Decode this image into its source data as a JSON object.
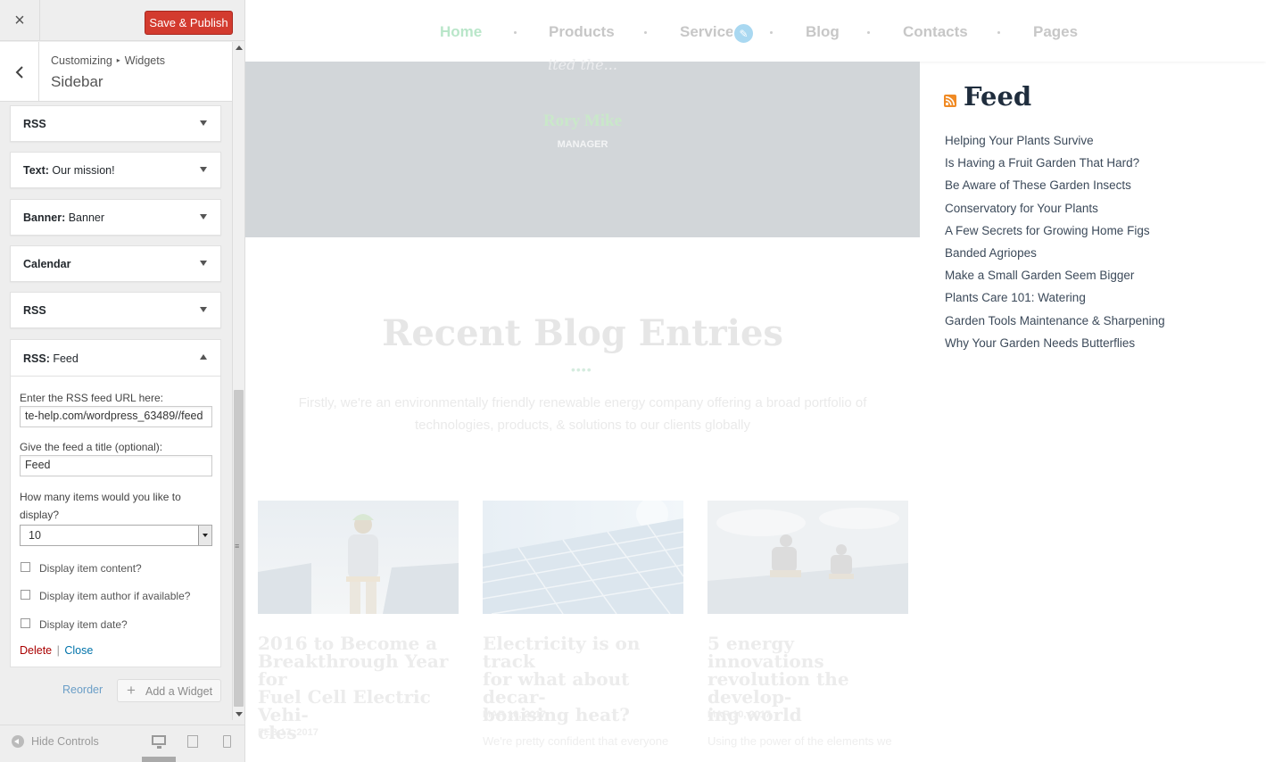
{
  "customizer": {
    "save_label": "Save & Publish",
    "close_icon": "×",
    "breadcrumb": {
      "root": "Customizing",
      "sep": "▸",
      "section": "Widgets"
    },
    "section_title": "Sidebar",
    "widgets": [
      {
        "type": "RSS",
        "title": ""
      },
      {
        "type": "Text:",
        "title": " Our mission!"
      },
      {
        "type": "Banner:",
        "title": " Banner"
      },
      {
        "type": "Calendar",
        "title": ""
      },
      {
        "type": "RSS",
        "title": ""
      }
    ],
    "open_widget": {
      "type": "RSS:",
      "title": " Feed",
      "url_label": "Enter the RSS feed URL here:",
      "url_value": "te-help.com/wordpress_63489//feed",
      "title_label": "Give the feed a title (optional):",
      "title_value": "Feed",
      "count_label_1": "How many items would you like to",
      "count_label_2": "display?",
      "count_value": "10",
      "checkboxes": [
        {
          "label": "Display item content?",
          "checked": false
        },
        {
          "label": "Display item author if available?",
          "checked": false
        },
        {
          "label": "Display item date?",
          "checked": false
        }
      ],
      "delete_label": "Delete",
      "separator": "|",
      "close_label": "Close"
    },
    "reorder_label": "Reorder",
    "add_widget_label": "Add a Widget",
    "hide_controls_label": "Hide Controls"
  },
  "preview": {
    "nav": [
      "Home",
      "Products",
      "Service",
      "Blog",
      "Contacts",
      "Pages"
    ],
    "nav_active": "Home",
    "hero": {
      "quote_fragment": "ited the...",
      "name": "Rory Mike",
      "role": "MANAGER"
    },
    "blog": {
      "title": "Recent Blog Entries",
      "dots": "••••",
      "subtitle_1": "Firstly, we're an environmentally friendly renewable energy company offering a broad portfolio of",
      "subtitle_2": "technologies, products, & solutions to our clients globally",
      "cards": [
        {
          "title_1": "2016 to Become a",
          "title_2": "Breakthrough Year for",
          "title_3": "Fuel Cell Electric Vehi-",
          "title_4": "cles",
          "date": "FEB 17, 2017",
          "excerpt": ""
        },
        {
          "title_1": "Electricity is on track",
          "title_2": "for what about decar-",
          "title_3": "bonising heat?",
          "title_4": "",
          "date": "MAR 10, 2017",
          "excerpt": "We're pretty confident that everyone"
        },
        {
          "title_1": "5 energy innovations",
          "title_2": "revolution the develop-",
          "title_3": "ing world",
          "title_4": "",
          "date": "MAR 10, 2017",
          "excerpt": "Using the power of the elements we"
        }
      ]
    },
    "feed": {
      "title": "Feed",
      "items": [
        "Helping Your Plants Survive",
        "Is Having a Fruit Garden That Hard?",
        "Be Aware of These Garden Insects",
        "Conservatory for Your Plants",
        "A Few Secrets for Growing Home Figs",
        "Banded Agriopes",
        "Make a Small Garden Seem Bigger",
        "Plants Care 101: Watering",
        "Garden Tools Maintenance & Sharpening",
        "Why Your Garden Needs Butterflies"
      ]
    }
  },
  "colors": {
    "save": "#d33b2f",
    "nav_active": "#b9e6c9",
    "feed_title": "#1f2d3d",
    "rss": "#f08a24"
  },
  "icons": [
    "close-icon",
    "back-arrow-icon",
    "chevron-down-icon",
    "chevron-up-icon",
    "plus-icon",
    "hide-controls-icon",
    "desktop-icon",
    "tablet-icon",
    "mobile-icon",
    "edit-pencil-icon",
    "rss-icon"
  ]
}
